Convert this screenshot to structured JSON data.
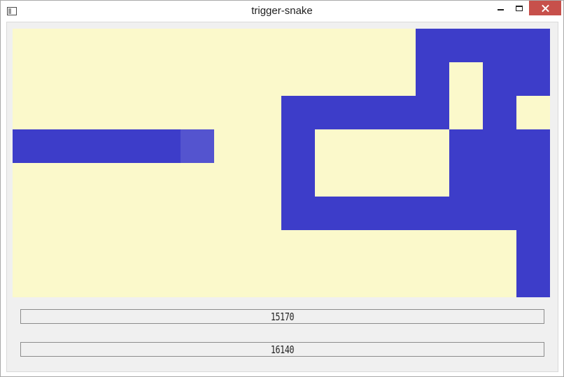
{
  "window": {
    "title": "trigger-snake"
  },
  "board": {
    "columns": 16,
    "rows": 8,
    "background_color": "#fbf9cb",
    "snake_color": "#3d3dc9",
    "head_color": "#5454cf",
    "grid": [
      "............XXXX",
      "............X.XX",
      "........XXXXX.X.",
      "SSSSSH..X....XXX",
      "........X....XXX",
      "........XXXXXXXX",
      "...............X",
      "...............X"
    ]
  },
  "counters": [
    "15170",
    "16140"
  ]
}
